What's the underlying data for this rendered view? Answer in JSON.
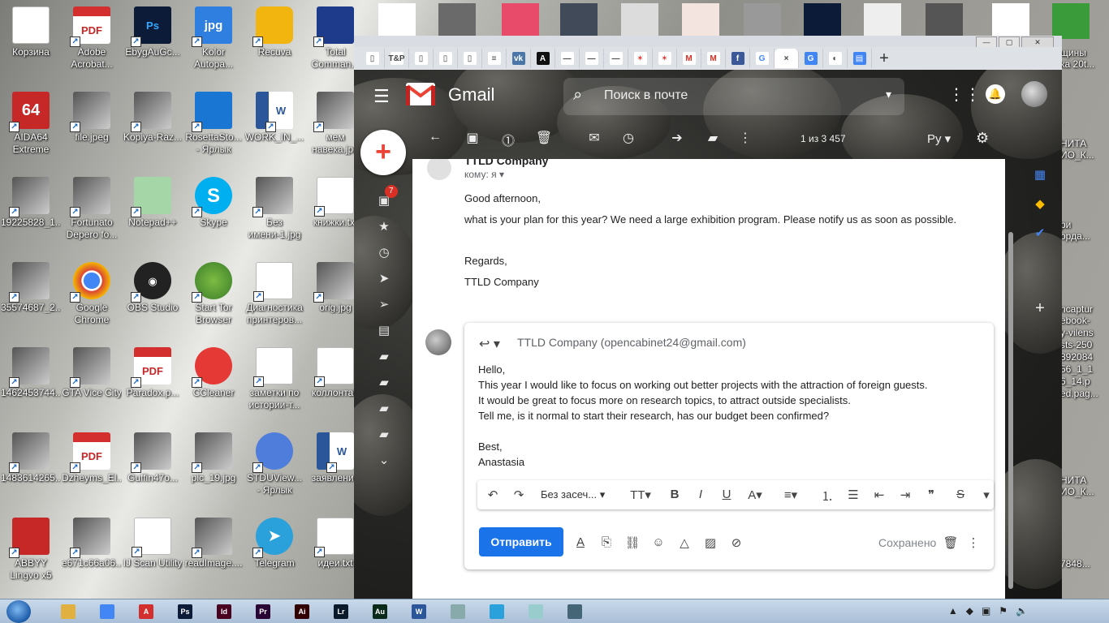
{
  "desktop": {
    "icons": [
      {
        "label": "Корзина",
        "icon": "recycle-bin-icon"
      },
      {
        "label": "Adobe Acrobat...",
        "icon": "pdf-icon"
      },
      {
        "label": "EbygAuGc...",
        "icon": "photoshop-icon"
      },
      {
        "label": "Kolor Autopa...",
        "icon": "jpg-icon"
      },
      {
        "label": "Recuva",
        "icon": "recuva-icon"
      },
      {
        "label": "Total Comman...",
        "icon": "total-commander-icon"
      },
      {
        "label": "AIDA64 Extreme",
        "icon": "aida64-icon"
      },
      {
        "label": "file.jpeg",
        "icon": "image-icon"
      },
      {
        "label": "Kopiya-Raz...",
        "icon": "image-icon"
      },
      {
        "label": "RosettaSto... - Ярлык",
        "icon": "rosetta-icon"
      },
      {
        "label": "WORK_IN_...",
        "icon": "word-icon"
      },
      {
        "label": "мем навека.jpg",
        "icon": "image-icon"
      },
      {
        "label": "19225828_1...",
        "icon": "image-icon"
      },
      {
        "label": "Fortunato Depero fo...",
        "icon": "image-icon"
      },
      {
        "label": "Notepad++",
        "icon": "notepad-icon"
      },
      {
        "label": "Skype",
        "icon": "skype-icon"
      },
      {
        "label": "Без имени-1.jpg",
        "icon": "image-icon"
      },
      {
        "label": "книжки.txt",
        "icon": "text-file-icon"
      },
      {
        "label": "35574687_2...",
        "icon": "image-icon"
      },
      {
        "label": "Google Chrome",
        "icon": "chrome-icon"
      },
      {
        "label": "OBS Studio",
        "icon": "obs-icon"
      },
      {
        "label": "Start Tor Browser",
        "icon": "tor-icon"
      },
      {
        "label": "Диагностика принтеров...",
        "icon": "printer-icon"
      },
      {
        "label": "orig.jpg",
        "icon": "image-icon"
      },
      {
        "label": "1462453744...",
        "icon": "image-icon"
      },
      {
        "label": "GTA Vice City",
        "icon": "game-icon"
      },
      {
        "label": "Paradox.p...",
        "icon": "pdf-icon"
      },
      {
        "label": "CCleaner",
        "icon": "ccleaner-icon"
      },
      {
        "label": "заметки по истории-т...",
        "icon": "text-file-icon"
      },
      {
        "label": "коллонтай",
        "icon": "text-file-icon"
      },
      {
        "label": "1483614265...",
        "icon": "image-icon"
      },
      {
        "label": "Dzheyms_El...",
        "icon": "pdf-icon"
      },
      {
        "label": "Guffin47o...",
        "icon": "image-icon"
      },
      {
        "label": "pic_19.jpg",
        "icon": "image-icon"
      },
      {
        "label": "STDUView... - Ярлык",
        "icon": "stdu-icon"
      },
      {
        "label": "заявление",
        "icon": "word-icon"
      },
      {
        "label": "ABBYY Lingvo x5",
        "icon": "abbyy-icon"
      },
      {
        "label": "e671c66a06...",
        "icon": "image-icon"
      },
      {
        "label": "IJ Scan Utility",
        "icon": "scanner-icon"
      },
      {
        "label": "readImage....",
        "icon": "image-icon"
      },
      {
        "label": "Telegram",
        "icon": "telegram-icon"
      },
      {
        "label": "идеи.txt",
        "icon": "text-file-icon"
      }
    ],
    "right_labels": [
      "щины",
      "ка 20t...",
      "НИТА",
      "ИО_К...",
      "ри",
      "орда...",
      "ncaptur",
      "ebook-",
      "y-vilens",
      "sts-250",
      "892084",
      "56_1_1",
      "6_14.p",
      "ed.pag...",
      "НИТА",
      "ИО_К...",
      "7848..."
    ]
  },
  "browser": {
    "tabs": [
      "pdf",
      "T&P",
      "pdf",
      "pdf",
      "pdf",
      "list",
      "VK",
      "A",
      "—",
      "—",
      "—",
      "red",
      "red",
      "M",
      "M",
      "f",
      "G",
      "×",
      "translate",
      "o",
      "docs"
    ],
    "window_buttons": [
      "—",
      "▢",
      "✕"
    ]
  },
  "gmail": {
    "app_name": "Gmail",
    "search_placeholder": "Поиск в почте",
    "pager": "1 из 3 457",
    "language": "Ру",
    "inbox_badge": "7",
    "message": {
      "sender": "TTLD Company",
      "to_line": "кому: я",
      "greeting": "Good afternoon,",
      "body": "what is your plan for this year? We need a large exhibition program. Please notify us as soon as possible.",
      "sign_regards": "Regards,",
      "sign_company": "TTLD Company"
    },
    "reply": {
      "recipient": "TTLD Company (opencabinet24@gmail.com)",
      "lines": [
        "Hello,",
        "This year I would like to focus on working out better projects with the attraction of foreign guests.",
        "It would be great to focus more on research topics, to attract outside specialists.",
        "Tell me, is it normal to start their research, has our budget been confirmed?",
        "",
        "Best,",
        "Anastasia"
      ],
      "font_name": "Без засеч...",
      "send_label": "Отправить",
      "saved_label": "Сохранено"
    }
  },
  "taskbar": {
    "apps": [
      {
        "name": "explorer",
        "color": "#e0b040",
        "txt": ""
      },
      {
        "name": "chrome",
        "color": "#4285f4",
        "txt": ""
      },
      {
        "name": "acrobat",
        "color": "#d32f2f",
        "txt": "A"
      },
      {
        "name": "photoshop",
        "color": "#0b1b38",
        "txt": "Ps"
      },
      {
        "name": "indesign",
        "color": "#49021f",
        "txt": "Id"
      },
      {
        "name": "premiere",
        "color": "#2a0634",
        "txt": "Pr"
      },
      {
        "name": "illustrator",
        "color": "#330000",
        "txt": "Ai"
      },
      {
        "name": "lightroom",
        "color": "#0a1a2a",
        "txt": "Lr"
      },
      {
        "name": "audition",
        "color": "#0a2a1a",
        "txt": "Au"
      },
      {
        "name": "word",
        "color": "#2b579a",
        "txt": "W"
      },
      {
        "name": "calculator",
        "color": "#8aa",
        "txt": ""
      },
      {
        "name": "telegram",
        "color": "#2aa1da",
        "txt": ""
      },
      {
        "name": "notepad",
        "color": "#9cc",
        "txt": ""
      },
      {
        "name": "monitor",
        "color": "#467",
        "txt": ""
      }
    ]
  }
}
